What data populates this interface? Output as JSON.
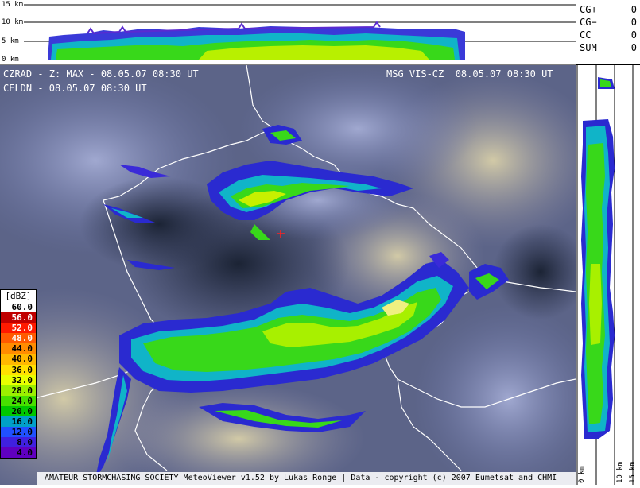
{
  "top_profile": {
    "axis_labels": [
      "15 km",
      "10 km",
      "5 km",
      "0 km"
    ]
  },
  "counters": [
    {
      "label": "CG+",
      "value": "0"
    },
    {
      "label": "CG−",
      "value": "0"
    },
    {
      "label": "CC",
      "value": "0"
    },
    {
      "label": "SUM",
      "value": "0"
    }
  ],
  "overlay": {
    "left_line1": "CZRAD - Z: MAX - 08.05.07 08:30 UT",
    "left_line2": "CELDN - 08.05.07 08:30 UT",
    "right_line1": "MSG VIS-CZ  08.05.07 08:30 UT"
  },
  "side_profile": {
    "axis_labels": [
      "0 km",
      "10 km",
      "15 km"
    ]
  },
  "legend": {
    "title": "[dBZ]",
    "levels": [
      {
        "label": "60.0",
        "color": "#ffffff",
        "text_color": "#000000"
      },
      {
        "label": "56.0",
        "color": "#c00000",
        "text_color": "#ffffff"
      },
      {
        "label": "52.0",
        "color": "#ff1a00",
        "text_color": "#ffffff"
      },
      {
        "label": "48.0",
        "color": "#ff5a00",
        "text_color": "#ffffff"
      },
      {
        "label": "44.0",
        "color": "#ff8c00",
        "text_color": "#000000"
      },
      {
        "label": "40.0",
        "color": "#ffb800",
        "text_color": "#000000"
      },
      {
        "label": "36.0",
        "color": "#ffe000",
        "text_color": "#000000"
      },
      {
        "label": "32.0",
        "color": "#e8ff00",
        "text_color": "#000000"
      },
      {
        "label": "28.0",
        "color": "#9cf000",
        "text_color": "#000000"
      },
      {
        "label": "24.0",
        "color": "#48e000",
        "text_color": "#000000"
      },
      {
        "label": "20.0",
        "color": "#00c800",
        "text_color": "#000000"
      },
      {
        "label": "16.0",
        "color": "#00a0c8",
        "text_color": "#000000"
      },
      {
        "label": "12.0",
        "color": "#2050ff",
        "text_color": "#000000"
      },
      {
        "label": "8.0",
        "color": "#4020e0",
        "text_color": "#000000"
      },
      {
        "label": "4.0",
        "color": "#6000c0",
        "text_color": "#000000"
      }
    ]
  },
  "footer": {
    "text": "AMATEUR STORMCHASING SOCIETY MeteoViewer v1.52 by Lukas Ronge | Data - copyright (c) 2007 Eumetsat and CHMI"
  }
}
